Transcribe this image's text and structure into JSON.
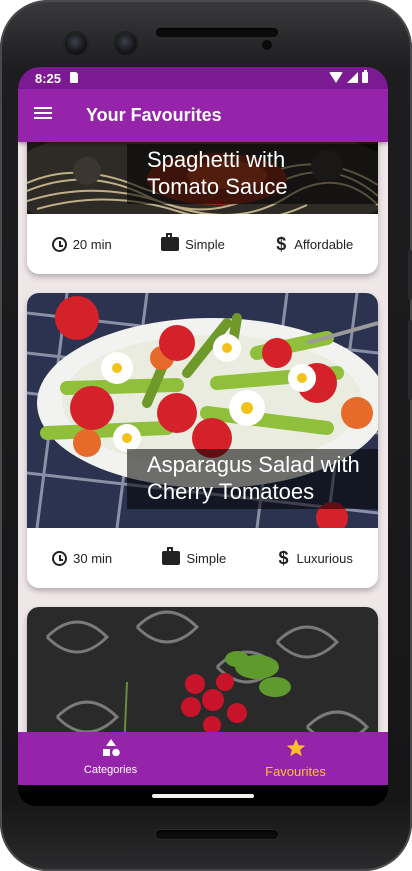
{
  "status_bar": {
    "time": "8:25"
  },
  "app_bar": {
    "title": "Your Favourites"
  },
  "meals": [
    {
      "title": "Spaghetti with Tomato Sauce",
      "duration": "20 min",
      "complexity": "Simple",
      "affordability": "Affordable"
    },
    {
      "title": "Asparagus Salad with Cherry Tomatoes",
      "duration": "30 min",
      "complexity": "Simple",
      "affordability": "Luxurious"
    },
    {
      "title": "",
      "duration": "",
      "complexity": "",
      "affordability": ""
    }
  ],
  "bottom_nav": {
    "items": [
      {
        "label": "Categories",
        "icon": "category-shapes-icon",
        "active": false
      },
      {
        "label": "Favourites",
        "icon": "star-icon",
        "active": true
      }
    ]
  },
  "colors": {
    "primary": "#9524ab",
    "status_bar": "#7b1a93",
    "accent": "#fcc02c",
    "background": "#efe6e8"
  }
}
